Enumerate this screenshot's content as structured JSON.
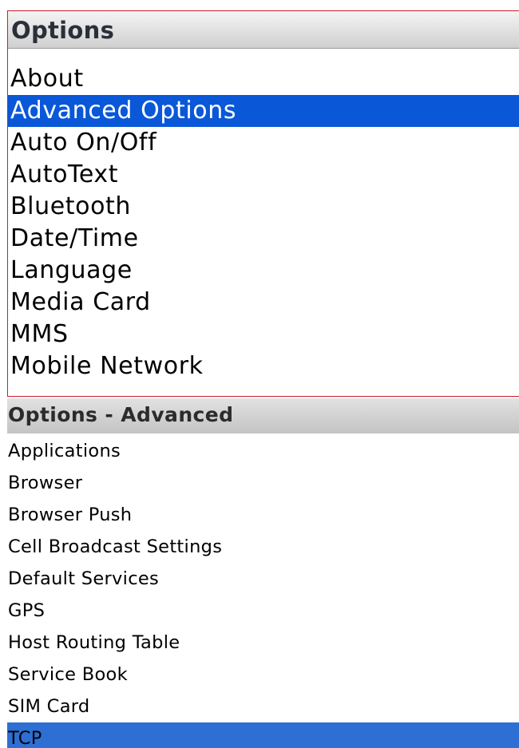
{
  "options_panel": {
    "title": "Options",
    "items": [
      {
        "label": "About"
      },
      {
        "label": "Advanced Options"
      },
      {
        "label": "Auto On/Off"
      },
      {
        "label": "AutoText"
      },
      {
        "label": "Bluetooth"
      },
      {
        "label": "Date/Time"
      },
      {
        "label": "Language"
      },
      {
        "label": "Media Card"
      },
      {
        "label": "MMS"
      },
      {
        "label": "Mobile Network"
      }
    ],
    "selected_index": 1
  },
  "advanced_panel": {
    "title": "Options - Advanced",
    "items": [
      {
        "label": "Applications"
      },
      {
        "label": "Browser"
      },
      {
        "label": "Browser Push"
      },
      {
        "label": "Cell Broadcast Settings"
      },
      {
        "label": "Default Services"
      },
      {
        "label": "GPS"
      },
      {
        "label": "Host Routing Table"
      },
      {
        "label": "Service Book"
      },
      {
        "label": "SIM Card"
      },
      {
        "label": "TCP"
      }
    ],
    "selected_index": 9
  },
  "colors": {
    "frame_border": "#c81e2c",
    "options_highlight": "#0a58d8",
    "advanced_highlight": "#2d6fd3"
  }
}
